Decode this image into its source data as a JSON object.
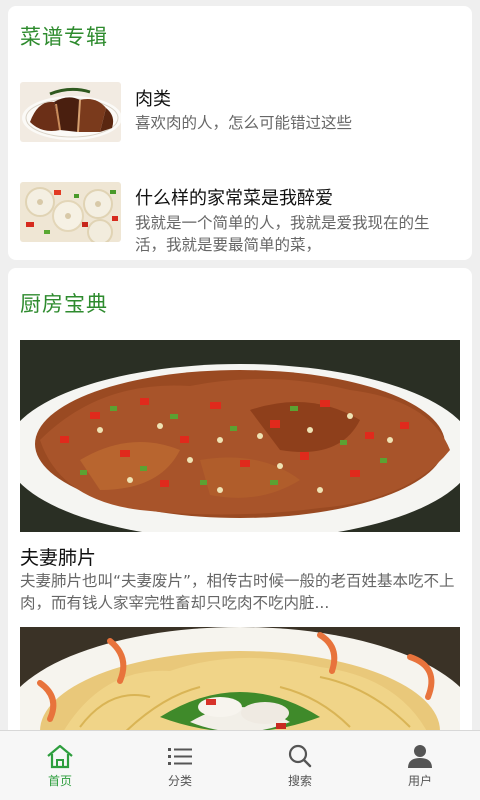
{
  "recipe_album": {
    "title": "菜谱专辑",
    "items": [
      {
        "title": "肉类",
        "desc": "喜欢肉的人，怎么可能错过这些"
      },
      {
        "title": "什么样的家常菜是我醉爱",
        "desc": "我就是一个简单的人，我就是爱我现在的生活，我就是要最简单的菜，"
      }
    ]
  },
  "kitchen_guide": {
    "title": "厨房宝典",
    "articles": [
      {
        "title": "夫妻肺片",
        "desc": "夫妻肺片也叫“夫妻废片”，相传古时候一般的老百姓基本吃不上肉，而有钱人家宰完牲畜却只吃肉不吃内脏..."
      }
    ]
  },
  "tabbar": {
    "items": [
      {
        "label": "首页",
        "icon": "home-icon",
        "active": true
      },
      {
        "label": "分类",
        "icon": "list-icon",
        "active": false
      },
      {
        "label": "搜索",
        "icon": "search-icon",
        "active": false
      },
      {
        "label": "用户",
        "icon": "user-icon",
        "active": false
      }
    ]
  },
  "colors": {
    "accent": "#2e8b2e",
    "tab_active": "#2e9e3e",
    "background": "#efefef"
  }
}
